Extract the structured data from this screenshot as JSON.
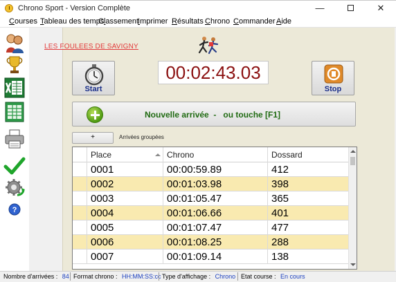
{
  "window": {
    "title": "Chrono Sport - Version Complète",
    "min_glyph": "—",
    "close_glyph": "✕"
  },
  "menu": [
    {
      "label": "Courses",
      "hotkey": "C",
      "rest": "ourses"
    },
    {
      "label": "Tableau des temps",
      "hotkey": "T",
      "rest": "ableau des temps"
    },
    {
      "label": "Classement",
      "hotkey": "l",
      "pre": "C",
      "rest": "assement"
    },
    {
      "label": "Imprimer",
      "hotkey": "I",
      "rest": "mprimer"
    },
    {
      "label": "Résultats",
      "hotkey": "R",
      "rest": "ésultats"
    },
    {
      "label": "Chrono",
      "hotkey": "C",
      "rest": "hrono"
    },
    {
      "label": "Commander",
      "hotkey": "C",
      "rest": "ommander"
    },
    {
      "label": "Aide",
      "hotkey": "A",
      "rest": "ide"
    }
  ],
  "sidebar_icons": [
    "users-icon",
    "trophy-icon",
    "excel-icon",
    "spreadsheet-icon",
    "printer-icon",
    "checkmark-icon",
    "settings-refresh-icon",
    "help-icon"
  ],
  "race": {
    "club_name": "LES FOULEES DE SAVIGNY"
  },
  "controls": {
    "start_label": "Start",
    "stop_label": "Stop",
    "timer_value": "00:02:43.03"
  },
  "arrival": {
    "text": "Nouvelle arrivée  -   ou touche [F1]"
  },
  "grouped": {
    "button_label": "+",
    "label": "Arrivées groupées"
  },
  "table": {
    "columns": [
      "Place",
      "Chrono",
      "Dossard"
    ],
    "rows": [
      {
        "place": "0001",
        "chrono": "00:00:59.89",
        "dossard": "412"
      },
      {
        "place": "0002",
        "chrono": "00:01:03.98",
        "dossard": "398"
      },
      {
        "place": "0003",
        "chrono": "00:01:05.47",
        "dossard": "365"
      },
      {
        "place": "0004",
        "chrono": "00:01:06.66",
        "dossard": "401"
      },
      {
        "place": "0005",
        "chrono": "00:01:07.47",
        "dossard": "477"
      },
      {
        "place": "0006",
        "chrono": "00:01:08.25",
        "dossard": "288"
      },
      {
        "place": "0007",
        "chrono": "00:01:09.14",
        "dossard": "138"
      }
    ]
  },
  "status": {
    "arrivals_label": "Nombre d'arrivées :",
    "arrivals_value": "84",
    "format_label": "Format chrono :",
    "format_value": "HH:MM:SS:cc",
    "display_label": "Type d'affichage :",
    "display_value": "Chrono",
    "state_label": "Etat course :",
    "state_value": "En cours"
  },
  "colors": {
    "timer_text": "#8b1010",
    "club_name": "#e23a3a",
    "arrival_text": "#1f6a11",
    "alt_row": "#f9eab0",
    "status_value": "#1a3fbf",
    "button_label": "#1a2f8a"
  }
}
